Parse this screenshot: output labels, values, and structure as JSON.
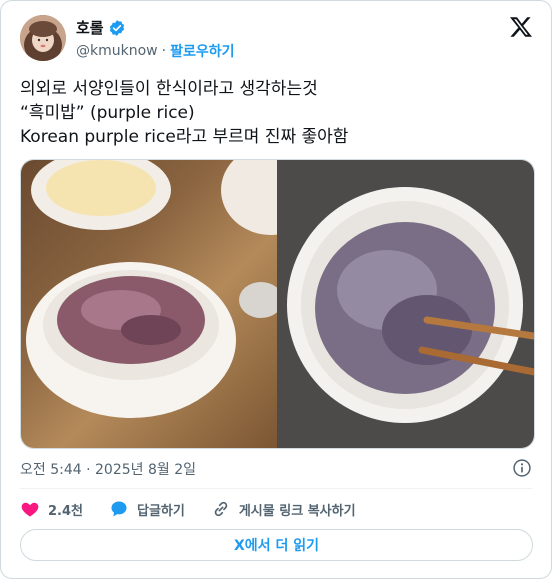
{
  "author": {
    "display_name": "호롤",
    "handle": "@kmuknow",
    "follow_label": "팔로우하기",
    "verified": true
  },
  "tweet": {
    "lines": [
      "의외로 서양인들이 한식이라고 생각하는것",
      "“흑미밥” (purple rice)",
      "Korean purple rice라고 부르며 진짜 좋아함"
    ],
    "timestamp": "오전 5:44 · 2025년 8월 2일"
  },
  "stats": {
    "likes": "2.4천",
    "reply_label": "답글하기",
    "copy_link_label": "게시물 링크 복사하기"
  },
  "read_more_label": "X에서 더 읽기",
  "colors": {
    "accent": "#1d9bf0",
    "like": "#f91880",
    "muted_text": "#536471",
    "border": "#cfd9de"
  },
  "icons": [
    "verified-badge-icon",
    "x-logo-icon",
    "info-icon",
    "heart-icon",
    "reply-bubble-icon",
    "link-icon"
  ]
}
